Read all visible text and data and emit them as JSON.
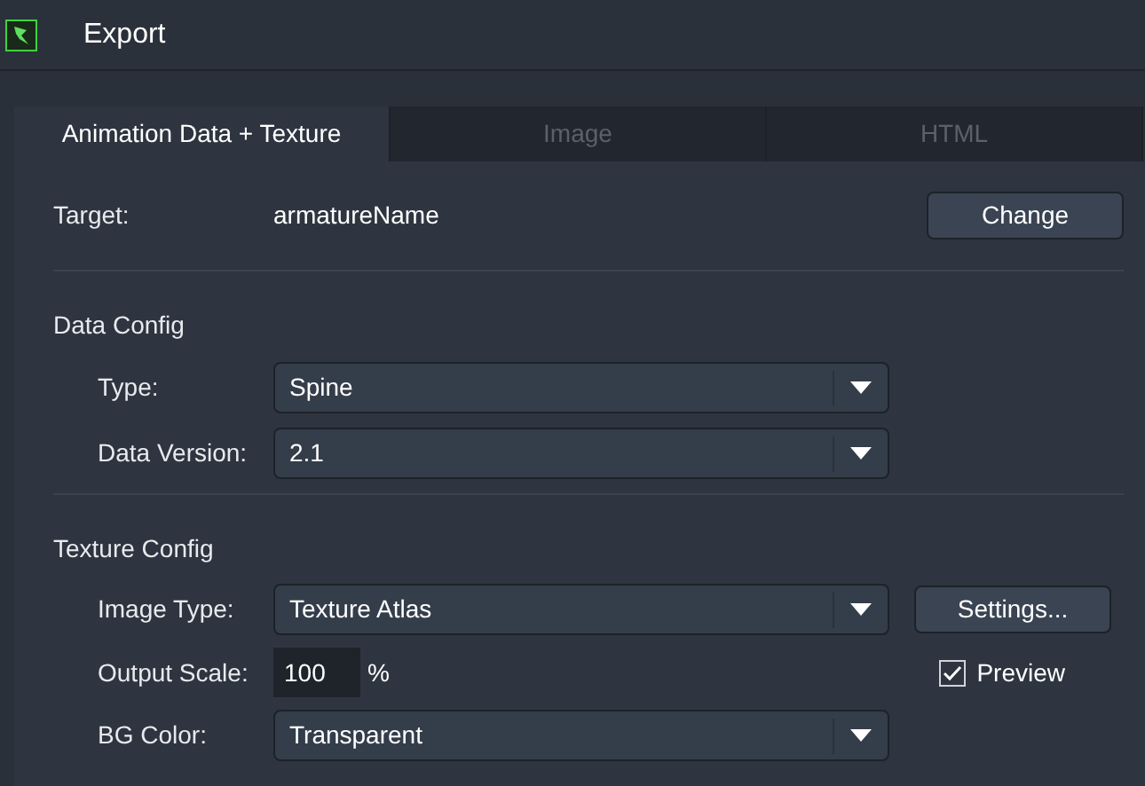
{
  "window": {
    "title": "Export"
  },
  "tabs": [
    {
      "label": "Animation Data + Texture",
      "selected": true
    },
    {
      "label": "Image",
      "selected": false
    },
    {
      "label": "HTML",
      "selected": false
    }
  ],
  "target": {
    "label": "Target:",
    "value": "armatureName",
    "button": "Change"
  },
  "data_config": {
    "title": "Data Config",
    "fields": [
      {
        "label": "Type:",
        "value": "Spine"
      },
      {
        "label": "Data Version:",
        "value": "2.1"
      }
    ]
  },
  "texture_config": {
    "title": "Texture Config",
    "image_type": {
      "label": "Image Type:",
      "value": "Texture Atlas",
      "button": "Settings..."
    },
    "output_scale": {
      "label": "Output Scale:",
      "value": "100",
      "unit": "%",
      "preview": {
        "label": "Preview",
        "checked": true
      }
    },
    "bg_color": {
      "label": "BG Color:",
      "value": "Transparent"
    }
  }
}
